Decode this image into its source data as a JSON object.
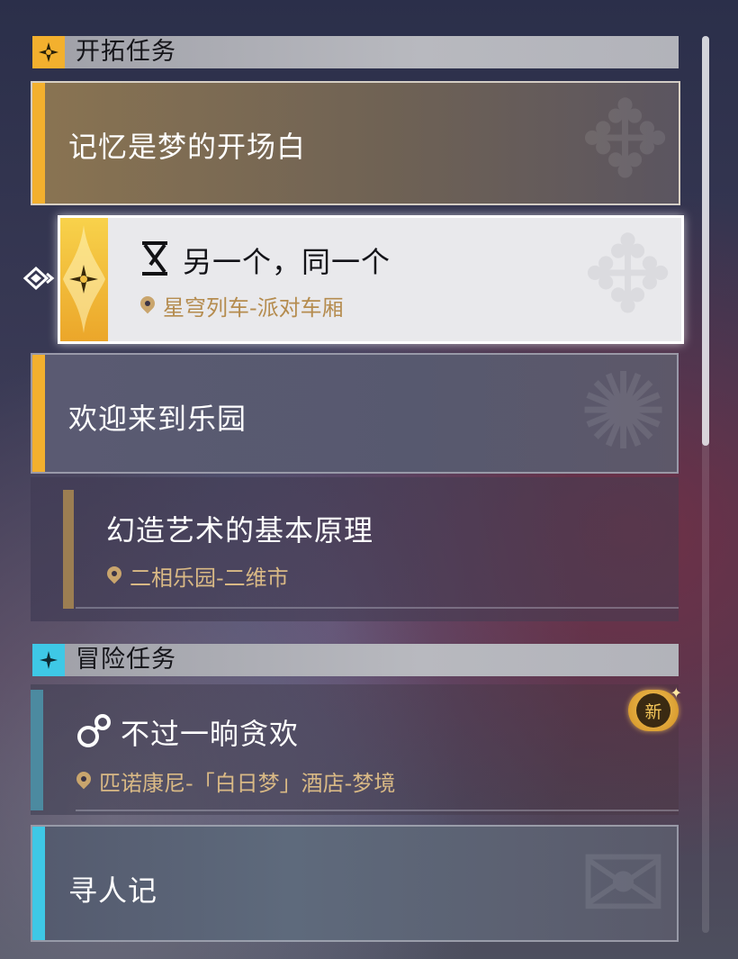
{
  "trailblaze": {
    "header": "开拓任务",
    "header_icon": "trailblaze-star-icon",
    "accent_color": "#f3b02e",
    "quest1": {
      "title": "记忆是梦的开场白"
    },
    "quest2": {
      "title": "另一个，同一个",
      "location": "星穹列车-派对车厢",
      "status_icon": "hourglass-icon",
      "selected": true
    },
    "quest3": {
      "title": "欢迎来到乐园"
    },
    "quest4": {
      "title": "幻造艺术的基本原理",
      "location": "二相乐园-二维市"
    }
  },
  "adventure": {
    "header": "冒险任务",
    "header_icon": "adventure-star-icon",
    "accent_color": "#3ec8e6",
    "quest1": {
      "title": "不过一晌贪欢",
      "location": "匹诺康尼-「白日梦」酒店-梦境",
      "new_badge": "新",
      "status_icon": "dream-bubble-icon"
    },
    "quest2": {
      "title": "寻人记"
    }
  },
  "scrollbar": {
    "position": 0
  }
}
